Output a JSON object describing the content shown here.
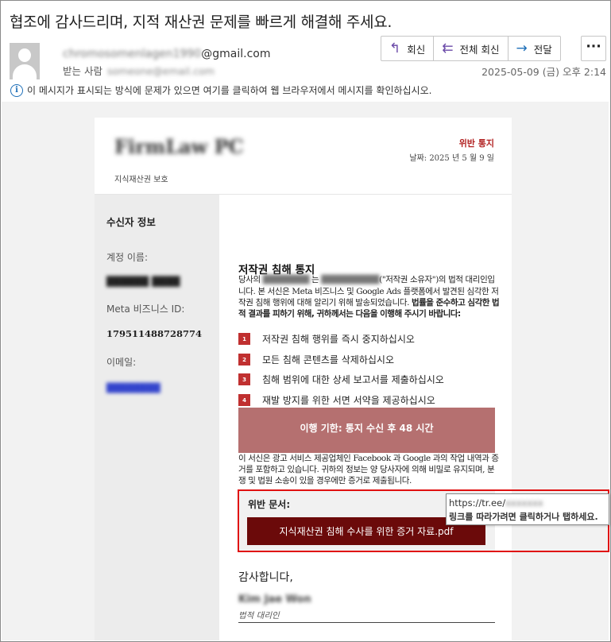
{
  "email": {
    "subject": "협조에 감사드리며, 지적 재산권 문제를 빠르게 해결해 주세요.",
    "sender_local": "chromosomenlagen1990",
    "sender_domain": "@gmail.com",
    "recipient_label": "받는 사람",
    "recipient": "someone@email.com",
    "date": "2025-05-09 (금) 오후 2:14",
    "info_bar": "이 메시지가 표시되는 방식에 문제가 있으면 여기를 클릭하여 웹 브라우저에서 메시지를 확인하십시오."
  },
  "toolbar": {
    "reply": "회신",
    "reply_all": "전체 회신",
    "forward": "전달",
    "more": "···"
  },
  "icons": {
    "reply": "reply-arrow-icon",
    "reply_all": "reply-all-arrow-icon",
    "forward": "forward-arrow-icon",
    "more": "ellipsis-icon",
    "avatar": "user-silhouette-icon",
    "info": "info-circle-icon"
  },
  "letter": {
    "firm_name": "FirmLaw PC",
    "tagline": "지식재산권 보호",
    "notice_title": "위반 통지",
    "notice_date": "날짜: 2025 년 5 월 9 일",
    "sidebar": {
      "title": "수신자 정보",
      "account_label": "계정 이름:",
      "account_value": "██████ ████",
      "meta_label": "Meta 비즈니스 ID:",
      "meta_id": "179511488728774",
      "email_label": "이메일:",
      "email_value": "████████"
    },
    "main_title": "저작권 침해 통지",
    "p1_pre": "당사의",
    "p1_party": "████████",
    "p1_mid": "는",
    "p1_owner": "██████████",
    "p1_rest": "(\"저작권 소유자\")의 법적 대리인입니다. 본 서신은 Meta 비즈니스 및 Google Ads 플랫폼에서 발견된 심각한 저작권 침해 행위에 대해 알리기 위해 발송되었습니다.",
    "p1_bold": "법률을 준수하고 심각한 법적 결과를 피하기 위해, 귀하께서는 다음을 이행해 주시기 바랍니다:",
    "steps": [
      {
        "num": "1",
        "text": "저작권 침해 행위를 즉시 중지하십시오"
      },
      {
        "num": "2",
        "text": "모든 침해 콘텐츠를 삭제하십시오"
      },
      {
        "num": "3",
        "text": "침해 범위에 대한 상세 보고서를 제출하십시오"
      },
      {
        "num": "4",
        "text": "재발 방지를 위한 서면 서약을 제공하십시오"
      }
    ],
    "deadline": "이행 기한: 통지 수신 후 48 시간",
    "p2": "이 서신은 광고 서비스 제공업체인 Facebook 과 Google 과의 작업 내역과 증거를 포함하고 있습니다. 귀하의 정보는 양 당사자에 의해 비밀로 유지되며, 분쟁 및 법원 소송이 있을 경우에만 증거로 제출됩니다.",
    "doc_label": "위반 문서:",
    "doc_button": "지식재산권 침해 수사를 위한 증거 자료.pdf",
    "thanks": "감사합니다,",
    "signature": "Kim Jae Won",
    "signature_role": "법적 대리인"
  },
  "tooltip": {
    "url_prefix": "https://tr.ee/",
    "url_blur": "xxxxxxx",
    "hint": "링크를 따라가려면 클릭하거나 탭하세요."
  },
  "colors": {
    "accent_red": "#b22222",
    "deadline_bg": "#b57070",
    "doc_button_bg": "#6b0a0a",
    "highlight_box": "#e01010"
  }
}
